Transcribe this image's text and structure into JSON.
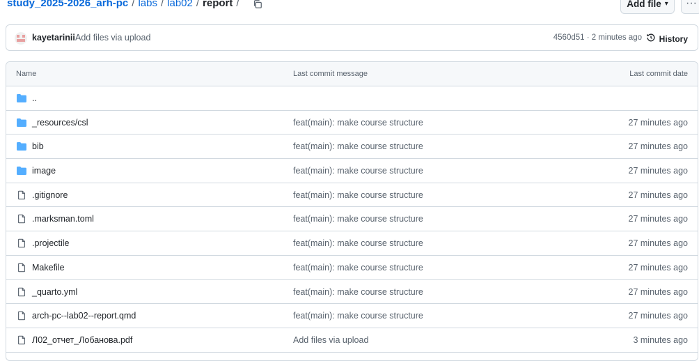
{
  "breadcrumb": {
    "repo": "study_2025-2026_arh-pc",
    "sep": "/",
    "path": [
      "labs",
      "lab02"
    ],
    "current": "report"
  },
  "toolbar": {
    "add_file_label": "Add file",
    "add_file_caret": "▾",
    "more_label": "···"
  },
  "commit": {
    "author": "kayetarinii",
    "message": "Add files via upload",
    "meta": "4560d51 · 2 minutes ago",
    "history_label": "History"
  },
  "table": {
    "headers": {
      "name": "Name",
      "message": "Last commit message",
      "date": "Last commit date"
    },
    "parent": "..",
    "rows": [
      {
        "name": "_resources/csl",
        "message": "feat(main): make course structure",
        "date": "27 minutes ago",
        "type": "folder"
      },
      {
        "name": "bib",
        "message": "feat(main): make course structure",
        "date": "27 minutes ago",
        "type": "folder"
      },
      {
        "name": "image",
        "message": "feat(main): make course structure",
        "date": "27 minutes ago",
        "type": "folder"
      },
      {
        "name": ".gitignore",
        "message": "feat(main): make course structure",
        "date": "27 minutes ago",
        "type": "file"
      },
      {
        "name": ".marksman.toml",
        "message": "feat(main): make course structure",
        "date": "27 minutes ago",
        "type": "file"
      },
      {
        "name": ".projectile",
        "message": "feat(main): make course structure",
        "date": "27 minutes ago",
        "type": "file"
      },
      {
        "name": "Makefile",
        "message": "feat(main): make course structure",
        "date": "27 minutes ago",
        "type": "file"
      },
      {
        "name": "_quarto.yml",
        "message": "feat(main): make course structure",
        "date": "27 minutes ago",
        "type": "file"
      },
      {
        "name": "arch-pc--lab02--report.qmd",
        "message": "feat(main): make course structure",
        "date": "27 minutes ago",
        "type": "file"
      },
      {
        "name": "Л02_отчет_Лобанова.pdf",
        "message": "Add files via upload",
        "date": "3 minutes ago",
        "type": "file"
      }
    ]
  },
  "colors": {
    "link": "#0969da",
    "folder": "#54aeff",
    "muted": "#59636e",
    "border": "#d1d9e0"
  }
}
